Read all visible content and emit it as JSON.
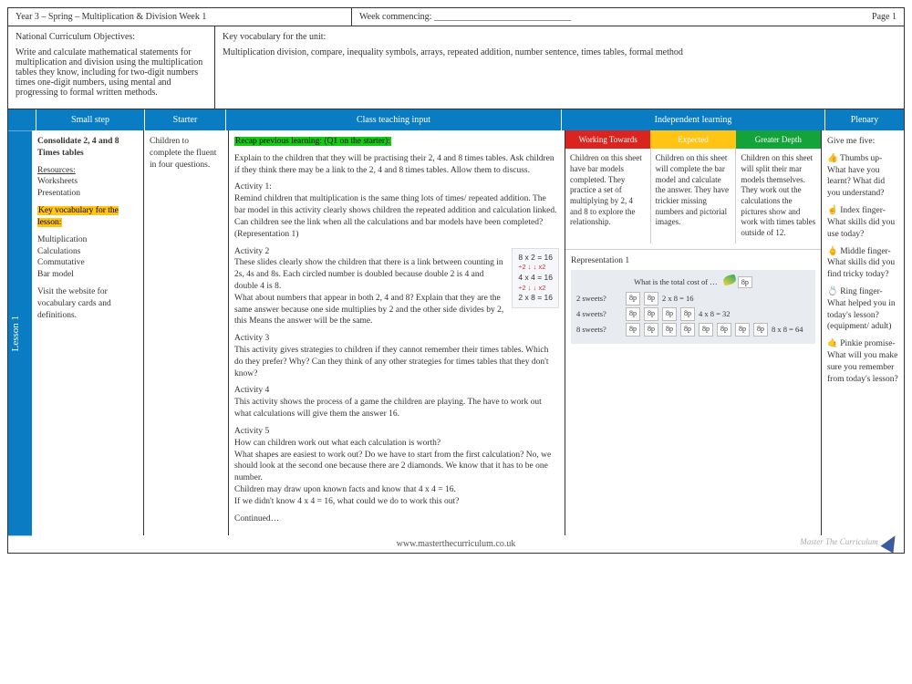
{
  "header": {
    "title": "Year 3 – Spring – Multiplication & Division Week 1",
    "week_label": "Week commencing: ______________________________",
    "page": "Page 1"
  },
  "meta": {
    "nco_title": "National Curriculum Objectives:",
    "nco_body": "Write and calculate mathematical statements for multiplication and division using the multiplication tables they know, including for two-digit numbers times one-digit numbers, using mental and progressing to formal written methods.",
    "vocab_title": "Key vocabulary for the unit:",
    "vocab_body": "Multiplication division, compare, inequality symbols, arrays, repeated addition, number sentence, times tables, formal method"
  },
  "cols": {
    "small": "Small step",
    "starter": "Starter",
    "teach": "Class teaching input",
    "indep": "Independent learning",
    "plenary": "Plenary"
  },
  "lesson_label": "Lesson 1",
  "small": {
    "title": "Consolidate 2, 4 and 8 Times tables",
    "res_label": "Resources:",
    "res_body": "Worksheets\nPresentation",
    "key_vocab_hl": "Key vocabulary for the lesson:",
    "vocab_list": "Multiplication\nCalculations\nCommutative\nBar model",
    "visit": "Visit the website for vocabulary cards and definitions."
  },
  "starter": "Children to complete the fluent in four questions.",
  "teach": {
    "recap": "Recap previous learning: (Q1 on the starter):",
    "intro": "Explain to the children that they will be practising their 2, 4 and 8 times tables. Ask children if they think there may be a link to the 2, 4 and 8 times tables. Allow them to discuss.",
    "a1t": "Activity 1:",
    "a1b": "Remind children that multiplication is the same thing lots of times/ repeated addition. The bar model in this activity clearly shows children the repeated addition and calculation linked.\nCan children see the link when all the calculations and bar models have been completed? (Representation 1)",
    "a2t": "Activity 2",
    "a2b1": "These slides clearly show the children that there is a link between counting in 2s, 4s and 8s. Each circled number is doubled because double 2 is 4 and double 4 is 8.",
    "a2b2": "What about numbers that appear in both 2, 4 and 8? Explain that they are the same answer because one side multiplies by 2 and the other side divides by 2, this Means the answer will be the same.",
    "calc1": "8 x 2 = 16",
    "calc_mid1": "÷2 ↓    ↓ x2",
    "calc2": "4 x 4 = 16",
    "calc_mid2": "÷2 ↓    ↓ x2",
    "calc3": "2 x 8 = 16",
    "a3t": "Activity 3",
    "a3b": "This activity gives strategies to children if they cannot remember their times tables. Which do they prefer? Why? Can they think of any other strategies for times tables that they don't know?",
    "a4t": "Activity 4",
    "a4b": "This activity shows the process of a game the children are playing. The have to work out what calculations will give them the answer 16.",
    "a5t": "Activity 5",
    "a5b": "How can children work out what each calculation is worth?\nWhat shapes are easiest to work out? Do we have to start from the first calculation? No, we should look at the second one because there are 2 diamonds. We know that it has to be one number.\nChildren may draw upon known facts and know that 4 x 4 = 16.\nIf we didn't know 4 x 4 = 16, what could we do to work this out?",
    "cont": "Continued…"
  },
  "indep": {
    "wt_h": "Working Towards",
    "ex_h": "Expected",
    "gd_h": "Greater Depth",
    "wt": "Children on this sheet have bar models completed. They practice a set of multiplying by 2, 4 and 8 to explore the relationship.",
    "ex": "Children on this sheet will complete the bar model and calculate the answer. They have trickier missing numbers and pictorial images.",
    "gd": "Children on this sheet will split their mar models themselves. They work out the calculations the pictures show and work with times tables outside of 12.",
    "rep_title": "Representation 1",
    "rep_q": "What is the total cost of …",
    "r2l": "2 sweets?",
    "r2c": "2 x 8 = 16",
    "r4l": "4 sweets?",
    "r4c": "4 x 8 = 32",
    "r8l": "8 sweets?",
    "r8c": "8 x 8 = 64",
    "eight": "8p"
  },
  "plenary": {
    "title": "Give me five:",
    "p1": "👍 Thumbs up- What have you learnt? What did you understand?",
    "p2": "☝ Index finger- What skills did you use today?",
    "p3": "🖕 Middle finger- What skills did you find tricky today?",
    "p4": "💍 Ring finger- What helped you in today's lesson? (equipment/ adult)",
    "p5": "🤙 Pinkie promise- What will you make sure you remember from today's lesson?"
  },
  "footer": "www.masterthecurriculum.co.uk",
  "brand": "Master The Curriculum"
}
